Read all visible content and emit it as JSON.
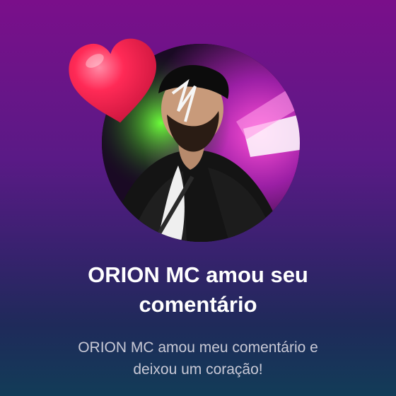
{
  "notification": {
    "title_line1": "ORION MC amou seu",
    "title_line2": "comentário",
    "message_line1": "ORION MC amou meu comentário e",
    "message_line2": "deixou um coração!"
  },
  "icons": {
    "heart": "heart-icon"
  },
  "colors": {
    "background_top": "#7a0f8a",
    "background_bottom": "#123c58",
    "heart": "#f0204a",
    "title": "#ffffff",
    "message": "#c9c9d6"
  }
}
